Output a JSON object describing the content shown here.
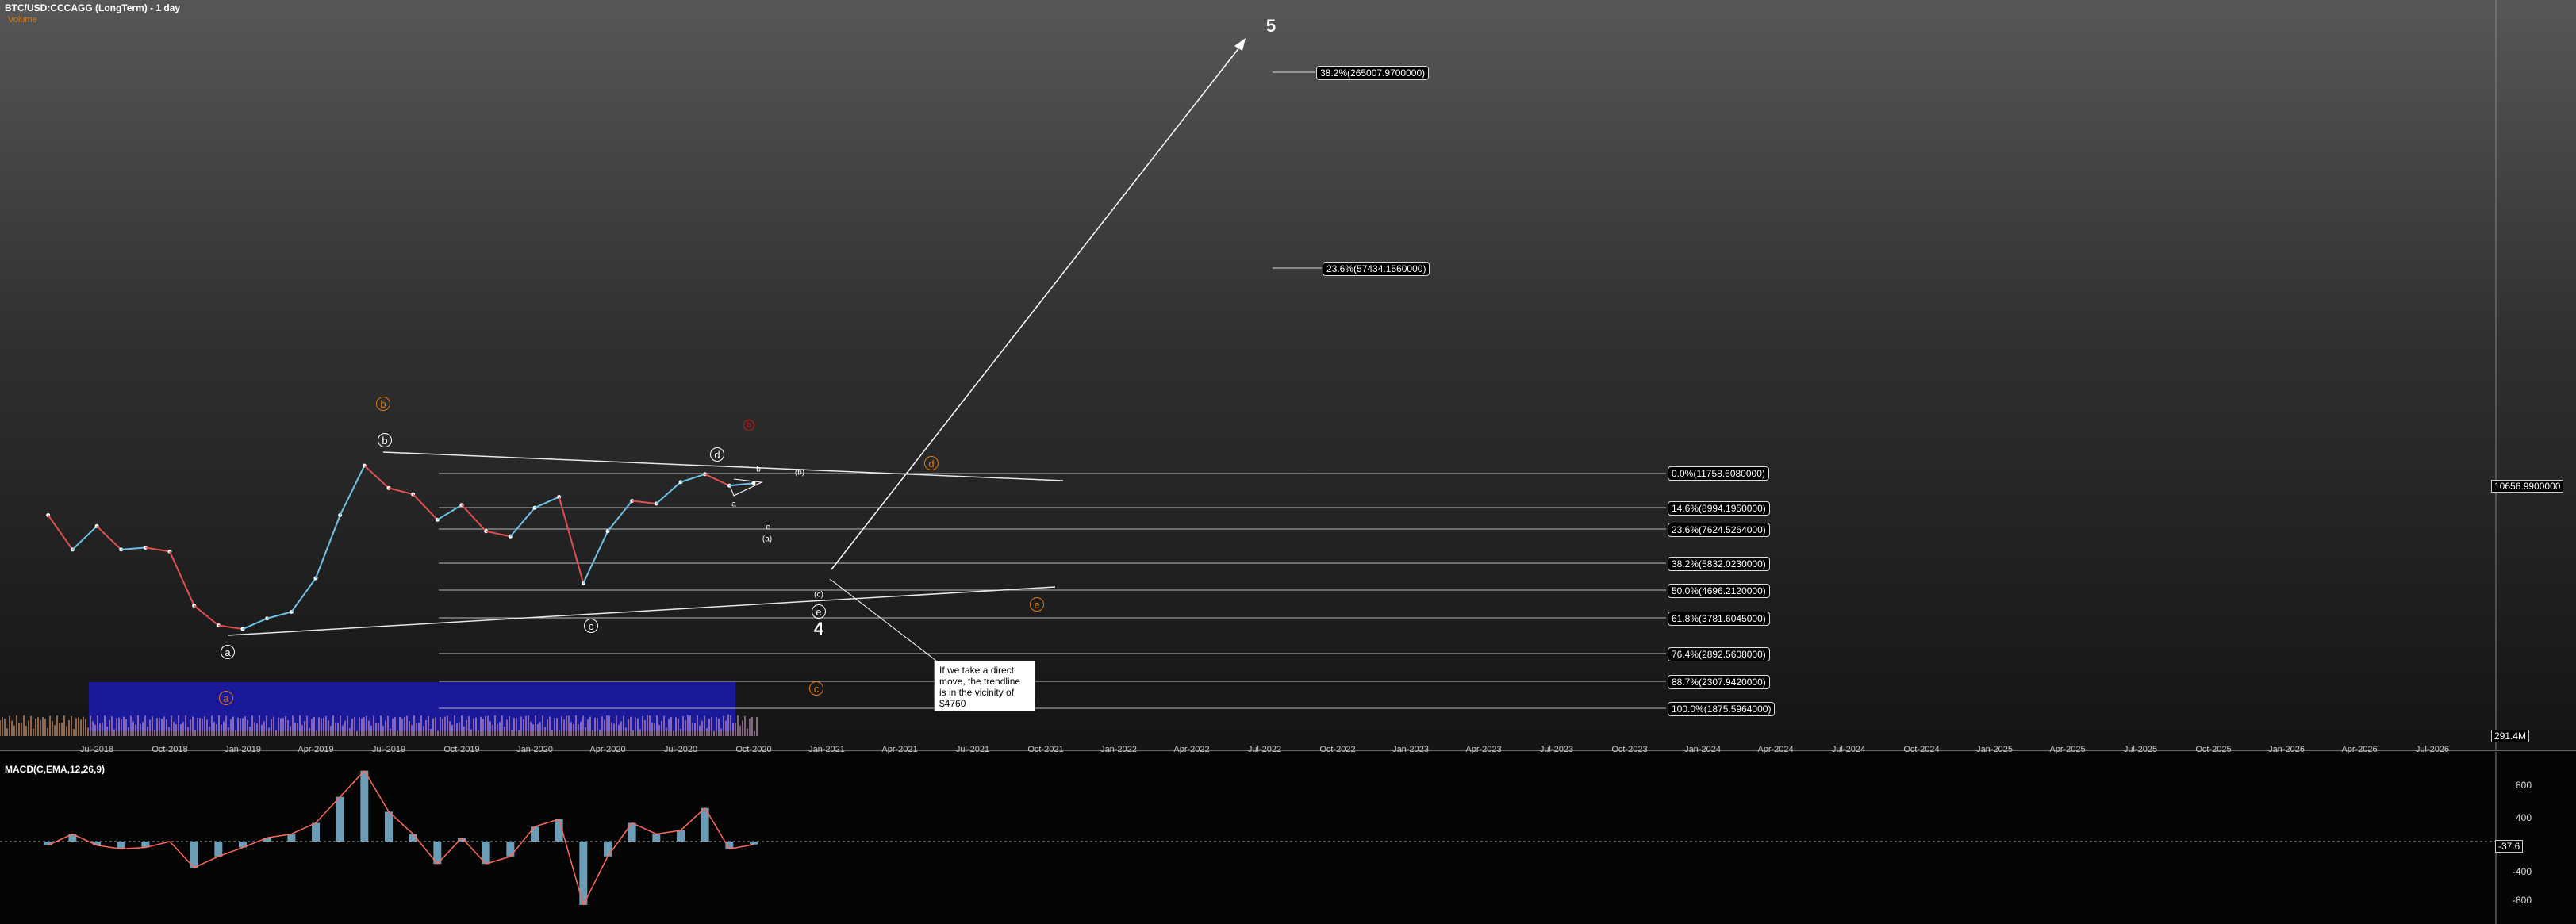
{
  "header": {
    "title": "BTC/USD:CCCAGG (LongTerm) - 1 day",
    "volume_label": "Volume"
  },
  "macd": {
    "title": "MACD(C,EMA,12,26,9)",
    "ticks": [
      "800",
      "400",
      "-400",
      "-800"
    ],
    "current_value": "-37.6"
  },
  "price_axis": {
    "current_price": "10656.9900000",
    "volume_value": "291.4M"
  },
  "fib_levels_lower": [
    {
      "label": "0.0%(11758.6080000)"
    },
    {
      "label": "14.6%(8994.1950000)"
    },
    {
      "label": "23.6%(7624.5264000)"
    },
    {
      "label": "38.2%(5832.0230000)"
    },
    {
      "label": "50.0%(4696.2120000)"
    },
    {
      "label": "61.8%(3781.6045000)"
    },
    {
      "label": "76.4%(2892.5608000)"
    },
    {
      "label": "88.7%(2307.9420000)"
    },
    {
      "label": "100.0%(1875.5964000)"
    }
  ],
  "fib_levels_upper": [
    {
      "label": "38.2%(265007.9700000)"
    },
    {
      "label": "23.6%(57434.1560000)"
    }
  ],
  "annotation": {
    "text": "If we take a direct move, the trendline is in the vicinity of $4760"
  },
  "wave_labels": {
    "five": "5",
    "four": "4",
    "a_white": "a",
    "b_white": "b",
    "c_white": "c",
    "d_white": "d",
    "e_white": "e",
    "b_orange": "b",
    "d_orange": "d",
    "e_orange": "e",
    "a_orange": "a",
    "c_orange": "c",
    "b_red": "b",
    "sub_b": "(b)",
    "sub_a": "(a)",
    "sub_c": "(c)",
    "tiny_a": "a",
    "tiny_b": "b",
    "tiny_c": "c"
  },
  "colors": {
    "orange": "#e07a10",
    "red": "#c41a1a",
    "volume_box": "#1a1ab0",
    "candle_up": "#6ec3e8",
    "candle_down": "#e05050"
  },
  "chart_data": [
    {
      "type": "line",
      "title": "BTC/USD:CCCAGG (LongTerm) - 1 day",
      "x_labels": [
        "Jul-2018",
        "Oct-2018",
        "Jan-2019",
        "Apr-2019",
        "Jul-2019",
        "Oct-2019",
        "Jan-2020",
        "Apr-2020",
        "Jul-2020",
        "Oct-2020",
        "Jan-2021",
        "Apr-2021",
        "Jul-2021",
        "Oct-2021",
        "Jan-2022",
        "Apr-2022",
        "Jul-2022",
        "Oct-2022",
        "Jan-2023",
        "Apr-2023",
        "Jul-2023",
        "Oct-2023",
        "Jan-2024",
        "Apr-2024",
        "Jul-2024",
        "Oct-2024",
        "Jan-2025",
        "Apr-2025",
        "Jul-2025",
        "Oct-2025",
        "Jan-2026",
        "Apr-2026",
        "Jul-2026"
      ],
      "series": [
        {
          "name": "BTC/USD",
          "x": [
            "2018-05",
            "2018-06",
            "2018-07",
            "2018-08",
            "2018-09",
            "2018-10",
            "2018-11",
            "2018-12",
            "2019-01",
            "2019-02",
            "2019-03",
            "2019-04",
            "2019-05",
            "2019-06",
            "2019-07",
            "2019-08",
            "2019-09",
            "2019-10",
            "2019-11",
            "2019-12",
            "2020-01",
            "2020-02",
            "2020-03",
            "2020-04",
            "2020-05",
            "2020-06",
            "2020-07",
            "2020-08",
            "2020-09",
            "2020-10"
          ],
          "values": [
            8500,
            6500,
            7800,
            6500,
            6600,
            6400,
            4200,
            3600,
            3500,
            3800,
            4000,
            5200,
            8500,
            12500,
            10500,
            10000,
            8200,
            9200,
            7500,
            7200,
            9000,
            9800,
            5000,
            7500,
            9500,
            9300,
            11000,
            11700,
            10700,
            10900
          ]
        }
      ]
    },
    {
      "type": "bar",
      "title": "MACD(C,EMA,12,26,9)",
      "ylim": [
        -1000,
        1000
      ],
      "x": [
        "2018-05",
        "2018-06",
        "2018-07",
        "2018-08",
        "2018-09",
        "2018-10",
        "2018-11",
        "2018-12",
        "2019-01",
        "2019-02",
        "2019-03",
        "2019-04",
        "2019-05",
        "2019-06",
        "2019-07",
        "2019-08",
        "2019-09",
        "2019-10",
        "2019-11",
        "2019-12",
        "2020-01",
        "2020-02",
        "2020-03",
        "2020-04",
        "2020-05",
        "2020-06",
        "2020-07",
        "2020-08",
        "2020-09",
        "2020-10"
      ],
      "values": [
        -50,
        100,
        -50,
        -100,
        -80,
        0,
        -350,
        -200,
        -80,
        50,
        100,
        250,
        600,
        950,
        400,
        100,
        -300,
        50,
        -300,
        -200,
        200,
        300,
        -850,
        -200,
        250,
        100,
        150,
        450,
        -100,
        -40
      ]
    }
  ]
}
